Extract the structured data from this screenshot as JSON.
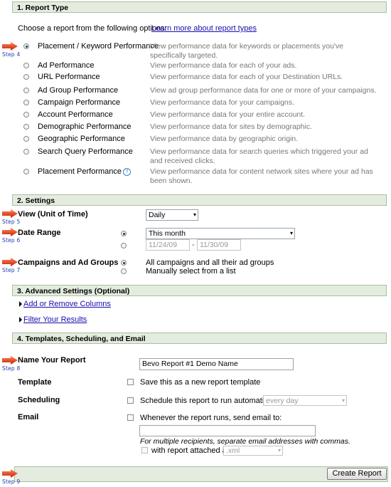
{
  "report_type": {
    "header": "1. Report Type",
    "intro": "Choose a report from the following options:",
    "learn_more": "Learn more about report types",
    "step": "Step 4",
    "options": [
      {
        "label": "Placement / Keyword Performance",
        "desc": "View performance data for keywords or placements you've specifically targeted.",
        "selected": true
      },
      {
        "label": "Ad Performance",
        "desc": "View performance data for each of your ads."
      },
      {
        "label": "URL Performance",
        "desc": "View performance data for each of your Destination URLs."
      },
      {
        "label": "Ad Group Performance",
        "desc": "View ad group performance data for one or more of your campaigns."
      },
      {
        "label": "Campaign Performance",
        "desc": "View performance data for your campaigns."
      },
      {
        "label": "Account Performance",
        "desc": "View performance data for your entire account."
      },
      {
        "label": "Demographic Performance",
        "desc": "View performance data for sites by demographic."
      },
      {
        "label": "Geographic Performance",
        "desc": "View performance data by geographic origin."
      },
      {
        "label": "Search Query Performance",
        "desc": "View performance data for search queries which triggered your ad and received clicks."
      },
      {
        "label": "Placement Performance",
        "desc": "View performance data for content network sites where your ad has been shown."
      }
    ]
  },
  "settings": {
    "header": "2. Settings",
    "view_label": "View (Unit of Time)",
    "view_value": "Daily",
    "step5": "Step 5",
    "date_range_label": "Date Range",
    "date_range_value": "This month",
    "date_from": "11/24/09",
    "date_sep": "-",
    "date_to": "11/30/09",
    "step6": "Step 6",
    "campaigns_label": "Campaigns and Ad Groups",
    "campaigns_opt1": "All campaigns and all their ad groups",
    "campaigns_opt2": "Manually select from a list",
    "step7": "Step 7"
  },
  "advanced": {
    "header": "3. Advanced Settings (Optional)",
    "add_remove_columns": "Add or Remove Columns",
    "filter_results": "Filter Your Results"
  },
  "templates": {
    "header": "4. Templates, Scheduling, and Email",
    "name_label": "Name Your Report",
    "name_value": "Bevo Report #1 Demo Name",
    "step8": "Step 8",
    "template_label": "Template",
    "template_text": "Save this as a new report template",
    "scheduling_label": "Scheduling",
    "scheduling_text": "Schedule this report to run automatically:",
    "scheduling_value": "every day",
    "email_label": "Email",
    "email_text": "Whenever the report runs, send email to:",
    "email_hint": "For multiple recipients, separate email addresses with commas.",
    "attach_text": "with report attached as:",
    "attach_value": ".xml"
  },
  "footer": {
    "create_button": "Create Report",
    "step9": "Step 9"
  },
  "colors": {
    "header_bg": "#e4ecdf",
    "arrow": "#e8391c",
    "step_text": "#1f3fb0",
    "link": "#1a0dab"
  }
}
